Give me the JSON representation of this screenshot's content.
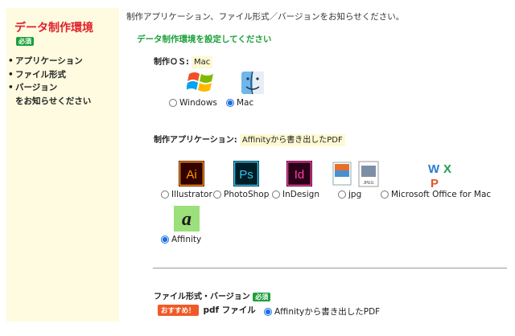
{
  "sidebar": {
    "title": "データ制作環境",
    "required_badge": "必須",
    "items": [
      {
        "bullet": "•",
        "label": "アプリケーション"
      },
      {
        "bullet": "•",
        "label": "ファイル形式"
      },
      {
        "bullet": "•",
        "label": "バージョン"
      }
    ],
    "tail": "をお知らせください"
  },
  "intro": "制作アプリケーション、ファイル形式／バージョンをお知らせください。",
  "section_title": "データ制作環境を設定してください",
  "os": {
    "label": "制作ＯＳ:",
    "value": "Mac",
    "options": [
      {
        "label": "Windows",
        "icon": "windows-logo-icon",
        "selected": false
      },
      {
        "label": "Mac",
        "icon": "mac-finder-icon",
        "selected": true
      }
    ]
  },
  "application": {
    "label": "制作アプリケーション:",
    "value": "Affinityから書き出したPDF",
    "options": [
      {
        "label": "Illustrator",
        "icon": "illustrator-icon",
        "icon_text": "Ai",
        "selected": false
      },
      {
        "label": "PhotoShop",
        "icon": "photoshop-icon",
        "icon_text": "Ps",
        "selected": false
      },
      {
        "label": "InDesign",
        "icon": "indesign-icon",
        "icon_text": "Id",
        "selected": false
      },
      {
        "label": "jpg",
        "icon": "jpg-file-icon",
        "icon_text": "JPEG",
        "selected": false
      },
      {
        "label": "Microsoft Office for Mac",
        "icon": "ms-office-icon",
        "icon_text": [
          "W",
          "X",
          "P"
        ],
        "selected": false
      },
      {
        "label": "Affinity",
        "icon": "affinity-icon",
        "icon_text": "a",
        "selected": true
      }
    ]
  },
  "file_format": {
    "label": "ファイル形式・バージョン",
    "required_badge": "必須",
    "recommend_badge": "おすすめ！",
    "format_label": "pdf ファイル",
    "option_label": "Affinityから書き出したPDF",
    "option_selected": true
  },
  "colors": {
    "sidebar_bg": "#fefbe0",
    "title_red": "#e0202a",
    "green": "#1aa03a",
    "radio_blue": "#1b6fe0",
    "recommend_orange": "#f05a28"
  }
}
